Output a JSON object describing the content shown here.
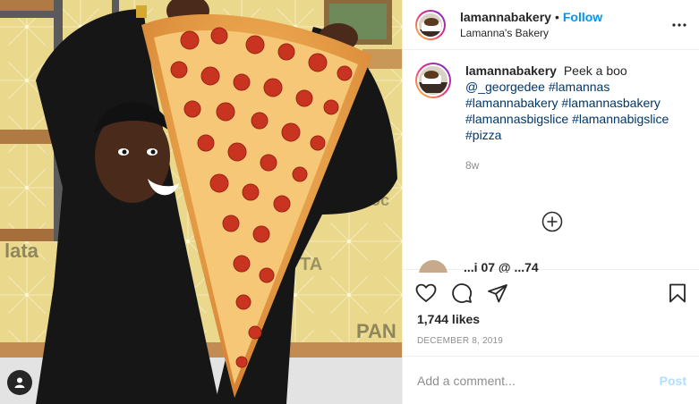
{
  "post": {
    "username": "lamannabakery",
    "separator": "•",
    "follow_label": "Follow",
    "location": "Lamanna's Bakery"
  },
  "caption": {
    "username": "lamannabakery",
    "text": "Peek a boo",
    "mention": "@_georgedee",
    "hashtags": [
      "#lamannas",
      "#lamannabakery",
      "#lamannasbakery",
      "#lamannasbigslice",
      "#lamannabigslice",
      "#pizza"
    ],
    "time_ago": "8w"
  },
  "next_comment": {
    "preview_text": "...i 07 @ ...74"
  },
  "actions": {
    "like_icon": "heart-icon",
    "comment_icon": "comment-icon",
    "share_icon": "paper-plane-icon",
    "save_icon": "bookmark-icon"
  },
  "likes_text": "1,744 likes",
  "date_text": "DECEMBER 8, 2019",
  "comment_box": {
    "placeholder": "Add a comment...",
    "post_label": "Post"
  },
  "colors": {
    "accent": "#0095f6",
    "post_disabled": "#b2dffc",
    "link": "#00376b",
    "muted": "#8e8e8e"
  }
}
